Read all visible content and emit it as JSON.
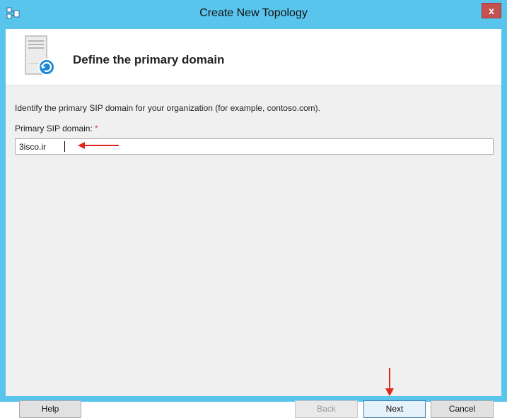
{
  "window": {
    "title": "Create New Topology",
    "close_label": "x"
  },
  "header": {
    "title": "Define the primary domain"
  },
  "body": {
    "instruction": "Identify the primary SIP domain for your organization (for example, contoso.com).",
    "field_label": "Primary SIP domain:",
    "required_marker": "*",
    "field_value": "3isco.ir"
  },
  "buttons": {
    "help": "Help",
    "back": "Back",
    "next": "Next",
    "cancel": "Cancel"
  },
  "colors": {
    "titlebar": "#59c5ec",
    "close": "#c75050",
    "annotation_arrow": "#e0261b",
    "required": "#e03c31"
  },
  "icons": {
    "app": "topology-builder-icon",
    "header": "server-refresh-icon"
  }
}
